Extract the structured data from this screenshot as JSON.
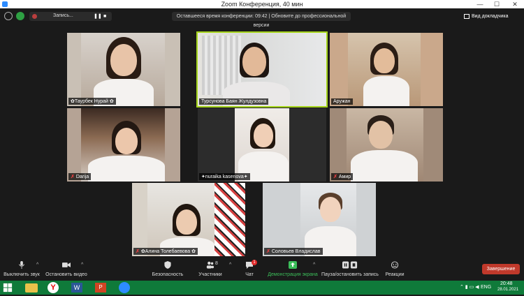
{
  "window": {
    "title": "Zoom Конференция, 40 мин",
    "minimize": "—",
    "maximize": "☐",
    "close": "✕"
  },
  "topbar": {
    "recording_label": "Запись...",
    "pause_glyph": "❚❚",
    "stop_glyph": "■",
    "meeting_info": "Оставшееся время конференции: 09:42 | Обновите до профессиональной версии",
    "view_label": "Вид докладчика"
  },
  "participants": [
    {
      "name": "✿Таурбек Нурай ✿",
      "muted": false
    },
    {
      "name": "Турсунова Баян Жулдузовна",
      "muted": false,
      "active": true
    },
    {
      "name": "Аружан",
      "muted": false
    },
    {
      "name": "Darija",
      "muted": true
    },
    {
      "name": "✦nuraika kasenova✦",
      "muted": false
    },
    {
      "name": "Амир",
      "muted": true
    },
    {
      "name": "✿Алина Толебаевова ✿",
      "muted": true
    },
    {
      "name": "Соловьев Владислав",
      "muted": true
    }
  ],
  "toolbar": {
    "mute": "Выключить звук",
    "video": "Остановить видео",
    "security": "Безопасность",
    "participants": "Участники",
    "participants_count": "8",
    "chat": "Чат",
    "chat_badge": "1",
    "share": "Демонстрация экрана",
    "record": "Пауза/остановить запись",
    "reactions": "Реакции",
    "end": "Завершение"
  },
  "taskbar": {
    "lang": "ENG",
    "time": "20:48",
    "date": "28.01.2021"
  },
  "colors": {
    "active_border": "#a5d51a",
    "end_red": "#c0392b",
    "share_green": "#3cbe5a",
    "taskbar": "#0f7a3a"
  }
}
